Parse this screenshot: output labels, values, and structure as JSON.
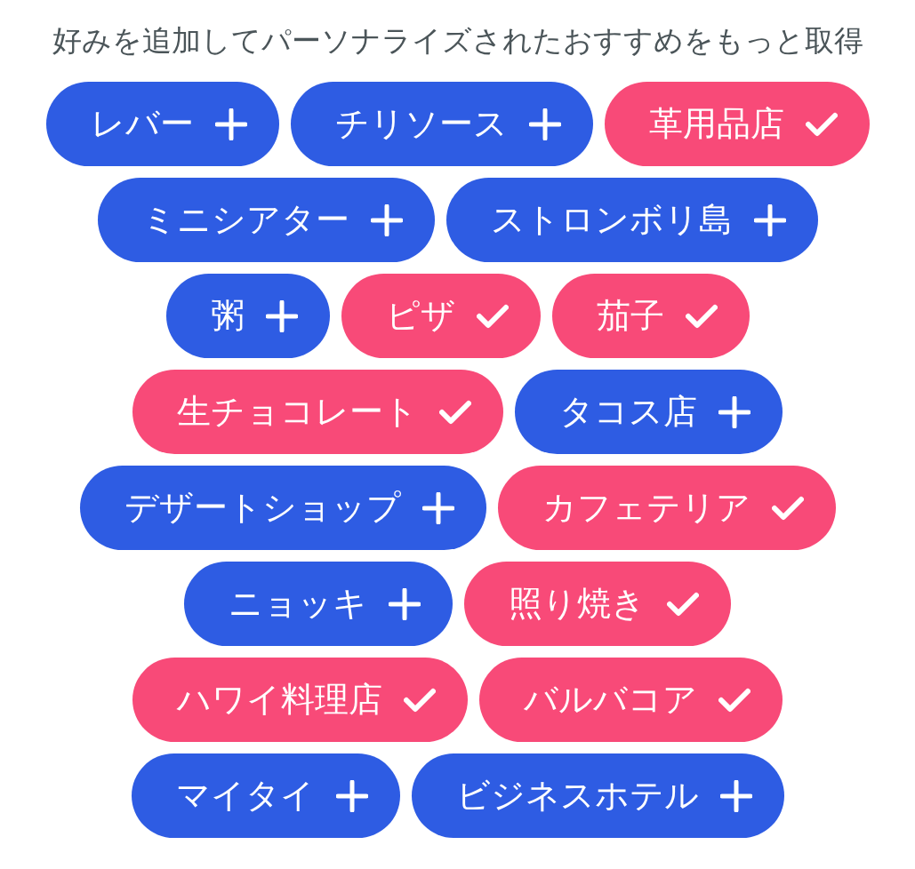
{
  "heading": "好みを追加してパーソナライズされたおすすめをもっと取得",
  "tag_rows": [
    {
      "tags": [
        {
          "label": "レバー",
          "selected": false
        },
        {
          "label": "チリソース",
          "selected": false
        },
        {
          "label": "革用品店",
          "selected": true
        }
      ]
    },
    {
      "tags": [
        {
          "label": "ミニシアター",
          "selected": false
        },
        {
          "label": "ストロンボリ島",
          "selected": false
        }
      ]
    },
    {
      "tags": [
        {
          "label": "粥",
          "selected": false
        },
        {
          "label": "ピザ",
          "selected": true
        },
        {
          "label": "茄子",
          "selected": true
        }
      ]
    },
    {
      "tags": [
        {
          "label": "生チョコレート",
          "selected": true
        },
        {
          "label": "タコス店",
          "selected": false
        }
      ]
    },
    {
      "tags": [
        {
          "label": "デザートショップ",
          "selected": false
        },
        {
          "label": "カフェテリア",
          "selected": true
        }
      ]
    },
    {
      "tags": [
        {
          "label": "ニョッキ",
          "selected": false
        },
        {
          "label": "照り焼き",
          "selected": true
        }
      ]
    },
    {
      "tags": [
        {
          "label": "ハワイ料理店",
          "selected": true
        },
        {
          "label": "バルバコア",
          "selected": true
        }
      ]
    },
    {
      "tags": [
        {
          "label": "マイタイ",
          "selected": false
        },
        {
          "label": "ビジネスホテル",
          "selected": false
        }
      ]
    }
  ]
}
